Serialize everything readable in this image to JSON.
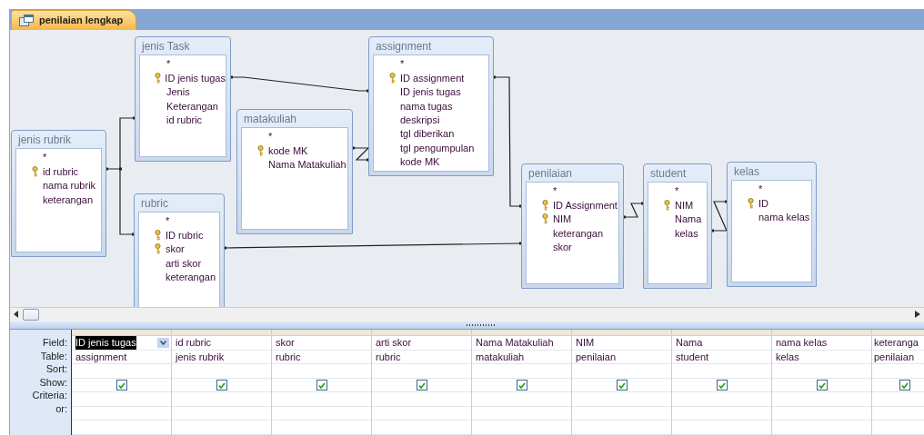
{
  "tab": {
    "title": "penilaian lengkap"
  },
  "tables": [
    {
      "name": "jenis Task",
      "fields": [
        {
          "name": "*",
          "primary_key": false
        },
        {
          "name": "ID jenis tugas",
          "primary_key": true
        },
        {
          "name": "Jenis",
          "primary_key": false
        },
        {
          "name": "Keterangan",
          "primary_key": false
        },
        {
          "name": "id rubric",
          "primary_key": false
        }
      ]
    },
    {
      "name": "jenis rubrik",
      "fields": [
        {
          "name": "*",
          "primary_key": false
        },
        {
          "name": "id rubric",
          "primary_key": true
        },
        {
          "name": "nama rubrik",
          "primary_key": false
        },
        {
          "name": "keterangan",
          "primary_key": false
        }
      ]
    },
    {
      "name": "matakuliah",
      "fields": [
        {
          "name": "*",
          "primary_key": false
        },
        {
          "name": "kode MK",
          "primary_key": true
        },
        {
          "name": "Nama Matakuliah",
          "primary_key": false
        }
      ]
    },
    {
      "name": "assignment",
      "fields": [
        {
          "name": "*",
          "primary_key": false
        },
        {
          "name": "ID assignment",
          "primary_key": true
        },
        {
          "name": "ID jenis tugas",
          "primary_key": false
        },
        {
          "name": "nama tugas",
          "primary_key": false
        },
        {
          "name": "deskripsi",
          "primary_key": false
        },
        {
          "name": "tgl diberikan",
          "primary_key": false
        },
        {
          "name": "tgl pengumpulan",
          "primary_key": false
        },
        {
          "name": "kode MK",
          "primary_key": false
        }
      ]
    },
    {
      "name": "rubric",
      "fields": [
        {
          "name": "*",
          "primary_key": false
        },
        {
          "name": "ID rubric",
          "primary_key": true
        },
        {
          "name": "skor",
          "primary_key": true
        },
        {
          "name": "arti skor",
          "primary_key": false
        },
        {
          "name": "keterangan",
          "primary_key": false
        }
      ]
    },
    {
      "name": "penilaian",
      "fields": [
        {
          "name": "*",
          "primary_key": false
        },
        {
          "name": "ID Assignment",
          "primary_key": true
        },
        {
          "name": "NIM",
          "primary_key": true
        },
        {
          "name": "keterangan",
          "primary_key": false
        },
        {
          "name": "skor",
          "primary_key": false
        }
      ]
    },
    {
      "name": "student",
      "fields": [
        {
          "name": "*",
          "primary_key": false
        },
        {
          "name": "NIM",
          "primary_key": true
        },
        {
          "name": "Nama",
          "primary_key": false
        },
        {
          "name": "kelas",
          "primary_key": false
        }
      ]
    },
    {
      "name": "kelas",
      "fields": [
        {
          "name": "*",
          "primary_key": false
        },
        {
          "name": "ID",
          "primary_key": true
        },
        {
          "name": "nama kelas",
          "primary_key": false
        }
      ]
    }
  ],
  "grid": {
    "row_labels": [
      "Field:",
      "Table:",
      "Sort:",
      "Show:",
      "Criteria:",
      "or:"
    ],
    "columns": [
      {
        "field": "ID jenis tugas",
        "table": "assignment",
        "show": true,
        "selected": true
      },
      {
        "field": "id rubric",
        "table": "jenis rubrik",
        "show": true,
        "selected": false
      },
      {
        "field": "skor",
        "table": "rubric",
        "show": true,
        "selected": false
      },
      {
        "field": "arti skor",
        "table": "rubric",
        "show": true,
        "selected": false
      },
      {
        "field": "Nama Matakuliah",
        "table": "matakuliah",
        "show": true,
        "selected": false
      },
      {
        "field": "NIM",
        "table": "penilaian",
        "show": true,
        "selected": false
      },
      {
        "field": "Nama",
        "table": "student",
        "show": true,
        "selected": false
      },
      {
        "field": "nama kelas",
        "table": "kelas",
        "show": true,
        "selected": false
      },
      {
        "field": "keteranga",
        "table": "penilaian",
        "show": true,
        "selected": false
      }
    ]
  }
}
